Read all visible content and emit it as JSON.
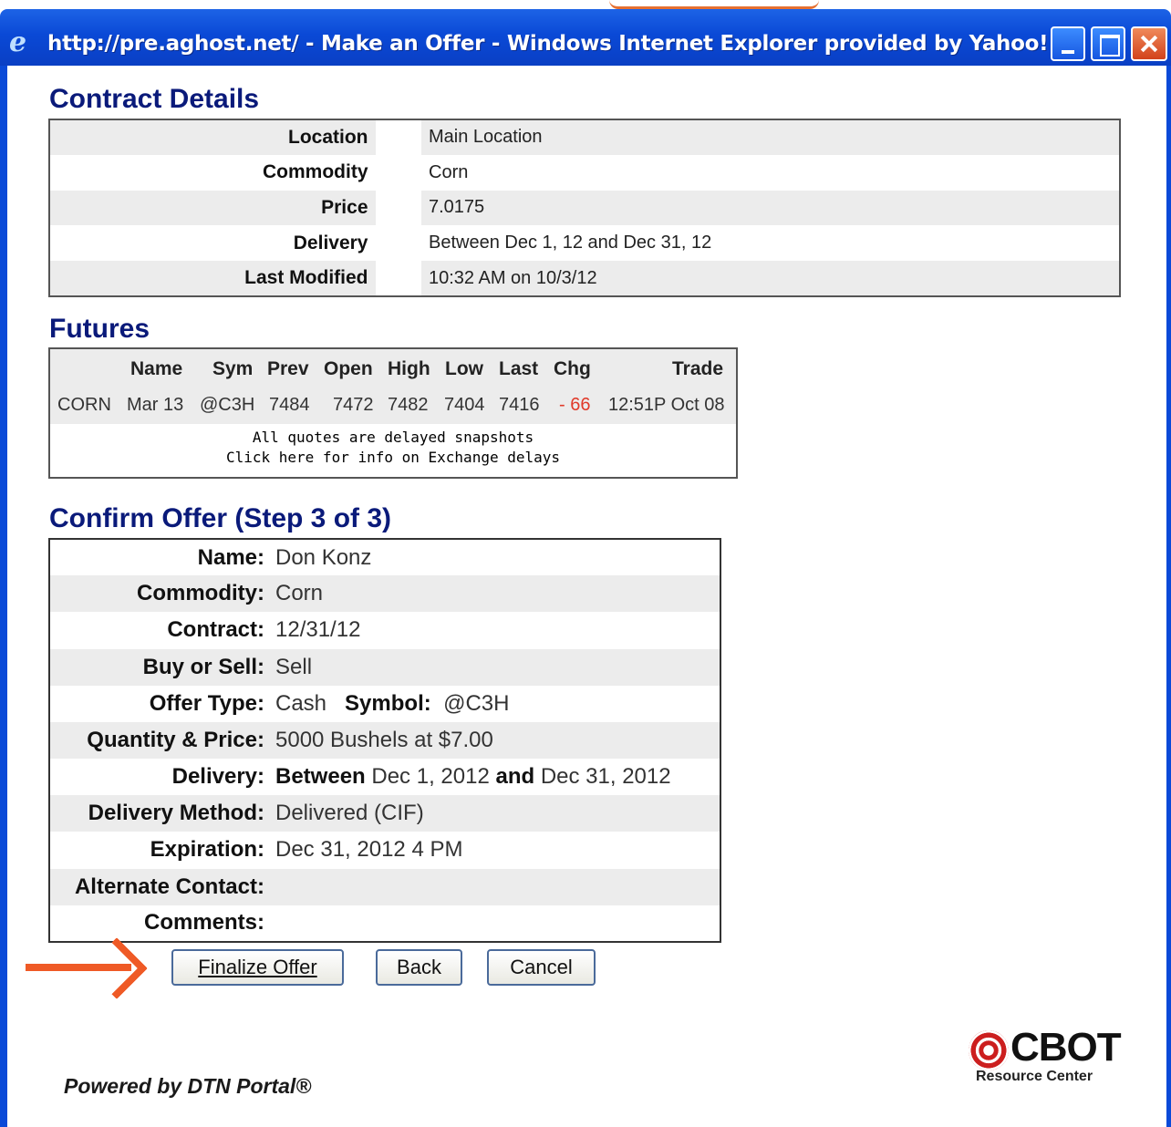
{
  "window": {
    "title": "http://pre.aghost.net/ - Make an Offer - Windows Internet Explorer provided by Yahoo!",
    "icon": "ie-icon",
    "controls": [
      "minimize-icon",
      "maximize-icon",
      "close-icon"
    ]
  },
  "contract_details": {
    "heading": "Contract Details",
    "rows": [
      {
        "label": "Location",
        "value": "Main Location"
      },
      {
        "label": "Commodity",
        "value": "Corn"
      },
      {
        "label": "Price",
        "value": "7.0175"
      },
      {
        "label": "Delivery",
        "value": "Between Dec 1, 12 and Dec 31, 12"
      },
      {
        "label": "Last Modified",
        "value": "10:32 AM on 10/3/12"
      }
    ]
  },
  "futures": {
    "heading": "Futures",
    "columns": [
      "Name",
      "Sym",
      "Prev",
      "Open",
      "High",
      "Low",
      "Last",
      "Chg",
      "Trade"
    ],
    "row": {
      "commodity": "CORN",
      "name": "Mar 13",
      "sym": "@C3H",
      "prev": "7484",
      "open": "7472",
      "high": "7482",
      "low": "7404",
      "last": "7416",
      "chg": "- 66",
      "trade": "12:51P Oct 08"
    },
    "note_line1": "All quotes are delayed snapshots",
    "note_line2": "Click here for info on Exchange delays",
    "negative_color": "#e03a2a"
  },
  "confirm_offer": {
    "heading": "Confirm Offer (Step 3 of 3)",
    "name": {
      "label": "Name:",
      "value": "Don Konz"
    },
    "commodity": {
      "label": "Commodity:",
      "value": "Corn"
    },
    "contract": {
      "label": "Contract:",
      "value": "12/31/12"
    },
    "buy_or_sell": {
      "label": "Buy or Sell:",
      "value": "Sell"
    },
    "offer_type": {
      "label": "Offer Type:",
      "value": "Cash",
      "symbol_label": "Symbol:",
      "symbol_value": "@C3H"
    },
    "quantity_price": {
      "label": "Quantity & Price:",
      "value": "5000 Bushels at $7.00"
    },
    "delivery": {
      "label": "Delivery:",
      "between": "Between",
      "start": "Dec 1, 2012",
      "and": "and",
      "end": "Dec 31, 2012"
    },
    "delivery_method": {
      "label": "Delivery Method:",
      "value": "Delivered (CIF)"
    },
    "expiration": {
      "label": "Expiration:",
      "value": "Dec 31, 2012 4 PM"
    },
    "alternate_contact": {
      "label": "Alternate Contact:",
      "value": ""
    },
    "comments": {
      "label": "Comments:",
      "value": ""
    }
  },
  "buttons": {
    "finalize": "Finalize Offer",
    "back": "Back",
    "cancel": "Cancel"
  },
  "annotation": {
    "arrow_color": "#ef5a26",
    "arrow_icon": "arrow-right-icon"
  },
  "footer": {
    "powered_by": "Powered by DTN Portal®",
    "logo_text": "CBOT",
    "logo_sub": "Resource Center"
  }
}
